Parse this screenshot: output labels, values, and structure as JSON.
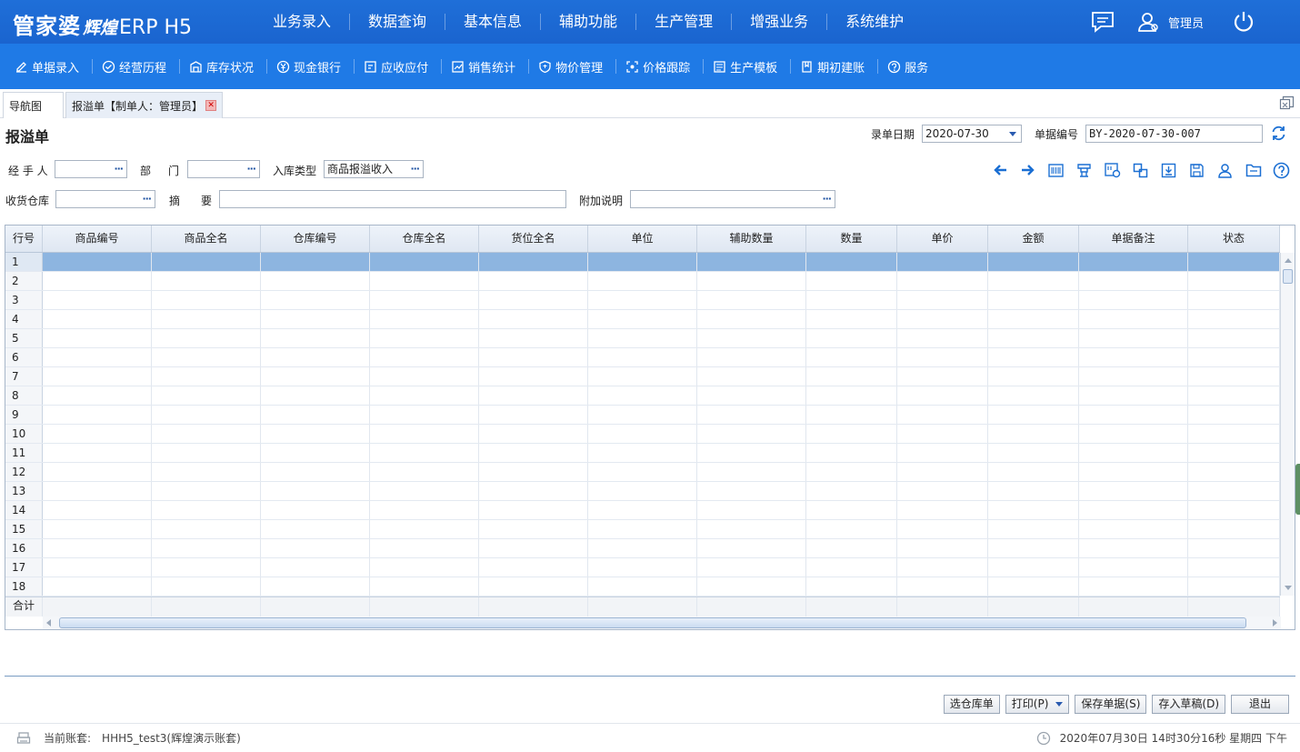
{
  "app": {
    "brand": "管家婆",
    "sub": "辉煌",
    "erp": "ERP H5"
  },
  "topnav": [
    "业务录入",
    "数据查询",
    "基本信息",
    "辅助功能",
    "生产管理",
    "增强业务",
    "系统维护"
  ],
  "user": {
    "name": "管理员"
  },
  "subnav": [
    {
      "label": "单据录入",
      "icon": "edit-icon"
    },
    {
      "label": "经营历程",
      "icon": "check-circle-icon"
    },
    {
      "label": "库存状况",
      "icon": "warehouse-icon"
    },
    {
      "label": "现金银行",
      "icon": "yuan-icon"
    },
    {
      "label": "应收应付",
      "icon": "ledger-icon"
    },
    {
      "label": "销售统计",
      "icon": "stats-icon"
    },
    {
      "label": "物价管理",
      "icon": "shield-icon"
    },
    {
      "label": "价格跟踪",
      "icon": "track-icon"
    },
    {
      "label": "生产模板",
      "icon": "template-icon"
    },
    {
      "label": "期初建账",
      "icon": "book-icon"
    },
    {
      "label": "服务",
      "icon": "help-icon"
    }
  ],
  "tabs": [
    {
      "label": "导航图"
    },
    {
      "label": "报溢单【制单人：管理员】"
    }
  ],
  "form": {
    "title": "报溢单",
    "date_label": "录单日期",
    "date_value": "2020-07-30",
    "no_label": "单据编号",
    "no_value": "BY-2020-07-30-007",
    "handler_label": "经 手 人",
    "dept_label_1": "部",
    "dept_label_2": "门",
    "instock_label": "入库类型",
    "instock_value": "商品报溢收入",
    "warehouse_label": "收货仓库",
    "summary_label_1": "摘",
    "summary_label_2": "要",
    "extra_label": "附加说明",
    "dots": "···"
  },
  "grid": {
    "columns": [
      "行号",
      "商品编号",
      "商品全名",
      "仓库编号",
      "仓库全名",
      "货位全名",
      "单位",
      "辅助数量",
      "数量",
      "单价",
      "金额",
      "单据备注",
      "状态"
    ],
    "rows": [
      "1",
      "2",
      "3",
      "4",
      "5",
      "6",
      "7",
      "8",
      "9",
      "10",
      "11",
      "12",
      "13",
      "14",
      "15",
      "16",
      "17",
      "18"
    ],
    "total_label": "合计"
  },
  "buttons": {
    "select_wh": "选仓库单",
    "print": "打印(P)",
    "save": "保存单据(S)",
    "draft": "存入草稿(D)",
    "exit": "退出"
  },
  "status": {
    "account_label": "当前账套:",
    "account_value": "HHH5_test3(辉煌演示账套)",
    "datetime": "2020年07月30日 14时30分16秒 星期四 下午"
  },
  "colors": {
    "topbar": "#1f6fd8",
    "subbar": "#1f7ae6",
    "selected_row": "#8db5e0",
    "icon_blue": "#1b6fd3"
  }
}
